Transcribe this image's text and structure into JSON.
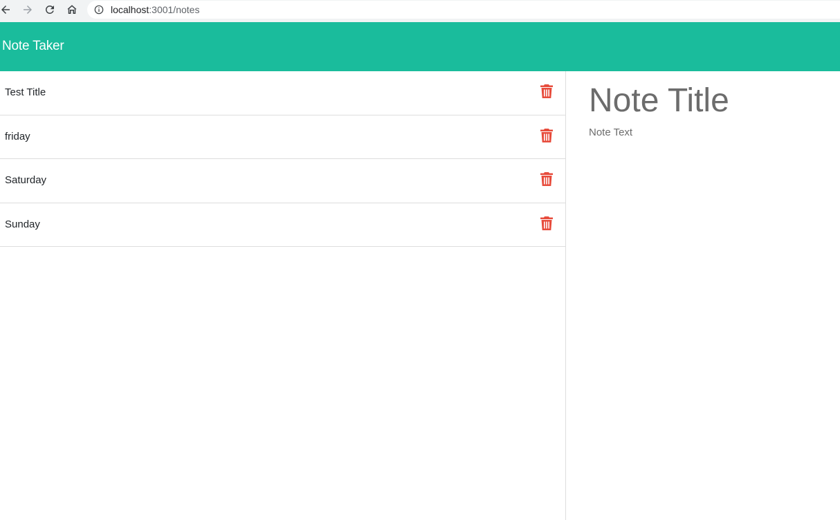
{
  "browser": {
    "url_host": "localhost",
    "url_path": ":3001/notes"
  },
  "header": {
    "title": "Note Taker",
    "background_color": "#1abc9c"
  },
  "notes": [
    {
      "title": "Test Title",
      "delete_icon": "trash-icon"
    },
    {
      "title": "friday",
      "delete_icon": "trash-icon"
    },
    {
      "title": "Saturday",
      "delete_icon": "trash-icon"
    },
    {
      "title": "Sunday",
      "delete_icon": "trash-icon"
    }
  ],
  "editor": {
    "title_placeholder": "Note Title",
    "text_placeholder": "Note Text"
  },
  "colors": {
    "delete_icon": "#e74c3c",
    "placeholder": "#6c6c6c"
  }
}
